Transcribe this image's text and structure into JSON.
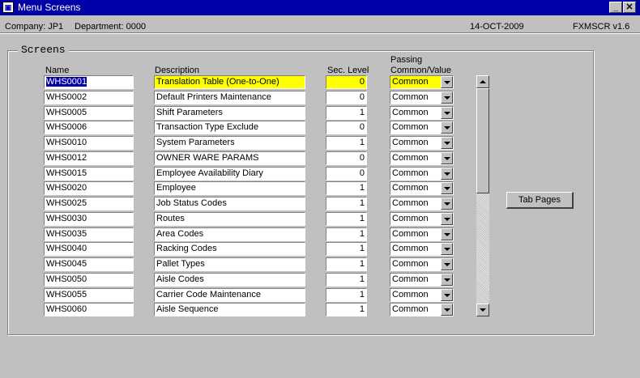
{
  "window": {
    "title": "Menu Screens"
  },
  "info": {
    "company": "Company:  JP1",
    "department": "Department:  0000",
    "date": "14-OCT-2009",
    "form_id": "FXMSCR  v1.6"
  },
  "section": {
    "title": "Screens"
  },
  "headers": {
    "name": "Name",
    "description": "Description",
    "sec_level": "Sec. Level",
    "passing": "Passing",
    "common_value": "Common/Value"
  },
  "rows": [
    {
      "name": "WHS0001",
      "description": "Translation Table (One-to-One)",
      "sec_level": "0",
      "passing": "Common"
    },
    {
      "name": "WHS0002",
      "description": "Default Printers Maintenance",
      "sec_level": "0",
      "passing": "Common"
    },
    {
      "name": "WHS0005",
      "description": "Shift Parameters",
      "sec_level": "1",
      "passing": "Common"
    },
    {
      "name": "WHS0006",
      "description": "Transaction Type Exclude",
      "sec_level": "0",
      "passing": "Common"
    },
    {
      "name": "WHS0010",
      "description": "System Parameters",
      "sec_level": "1",
      "passing": "Common"
    },
    {
      "name": "WHS0012",
      "description": "OWNER WARE PARAMS",
      "sec_level": "0",
      "passing": "Common"
    },
    {
      "name": "WHS0015",
      "description": "Employee Availability Diary",
      "sec_level": "0",
      "passing": "Common"
    },
    {
      "name": "WHS0020",
      "description": "Employee",
      "sec_level": "1",
      "passing": "Common"
    },
    {
      "name": "WHS0025",
      "description": "Job Status Codes",
      "sec_level": "1",
      "passing": "Common"
    },
    {
      "name": "WHS0030",
      "description": "Routes",
      "sec_level": "1",
      "passing": "Common"
    },
    {
      "name": "WHS0035",
      "description": "Area Codes",
      "sec_level": "1",
      "passing": "Common"
    },
    {
      "name": "WHS0040",
      "description": "Racking Codes",
      "sec_level": "1",
      "passing": "Common"
    },
    {
      "name": "WHS0045",
      "description": "Pallet Types",
      "sec_level": "1",
      "passing": "Common"
    },
    {
      "name": "WHS0050",
      "description": "Aisle Codes",
      "sec_level": "1",
      "passing": "Common"
    },
    {
      "name": "WHS0055",
      "description": "Carrier Code Maintenance",
      "sec_level": "1",
      "passing": "Common"
    },
    {
      "name": "WHS0060",
      "description": "Aisle Sequence",
      "sec_level": "1",
      "passing": "Common"
    }
  ],
  "buttons": {
    "tab_pages": "Tab Pages"
  },
  "colors": {
    "title_bar": "#0000a8",
    "current_record": "#ffff00",
    "background": "#c0c0c0"
  }
}
